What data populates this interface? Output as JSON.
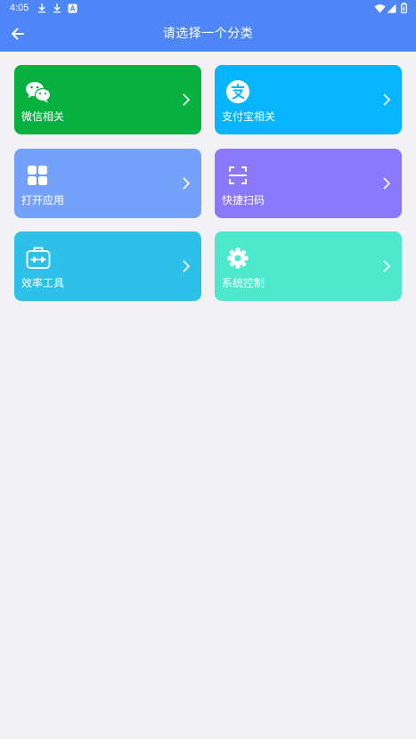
{
  "status_bar": {
    "time": "4:05",
    "icons": [
      "download-icon",
      "download-icon",
      "notification-a-icon",
      "wifi-icon",
      "signal-icon",
      "battery-icon"
    ]
  },
  "app_bar": {
    "title": "请选择一个分类",
    "back_icon": "arrow-left-icon"
  },
  "categories": [
    {
      "label": "微信相关",
      "icon": "wechat-icon",
      "color": "#06b13f"
    },
    {
      "label": "支付宝相关",
      "icon": "alipay-icon",
      "color": "#06b4ff"
    },
    {
      "label": "打开应用",
      "icon": "apps-grid-icon",
      "color": "#74a2fb"
    },
    {
      "label": "快捷扫码",
      "icon": "scan-icon",
      "color": "#8b78fd"
    },
    {
      "label": "效率工具",
      "icon": "toolbox-icon",
      "color": "#2dc1e9"
    },
    {
      "label": "系统控制",
      "icon": "gear-icon",
      "color": "#4de9cc"
    }
  ],
  "colors": {
    "primary": "#4f86f7",
    "background": "#f2f2f4"
  }
}
